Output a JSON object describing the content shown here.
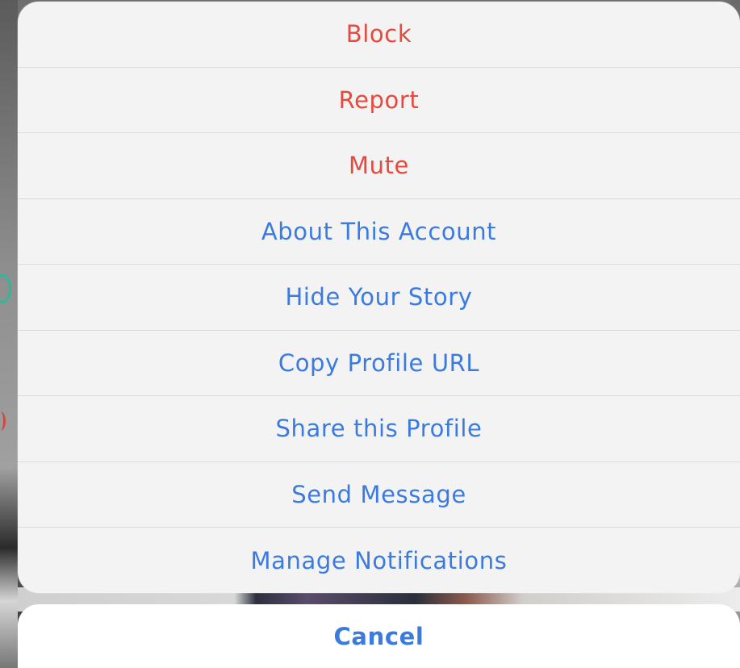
{
  "action_sheet": {
    "items": [
      {
        "label": "Block",
        "style": "destructive"
      },
      {
        "label": "Report",
        "style": "destructive"
      },
      {
        "label": "Mute",
        "style": "destructive"
      },
      {
        "label": "About This Account",
        "style": "default"
      },
      {
        "label": "Hide Your Story",
        "style": "default"
      },
      {
        "label": "Copy Profile URL",
        "style": "default"
      },
      {
        "label": "Share this Profile",
        "style": "default"
      },
      {
        "label": "Send Message",
        "style": "default"
      },
      {
        "label": "Manage Notifications",
        "style": "default"
      }
    ]
  },
  "cancel": {
    "label": "Cancel"
  },
  "colors": {
    "destructive": "#e44a3e",
    "default": "#3b7be0",
    "sheet_background": "#f3f3f3",
    "cancel_background": "#ffffff"
  }
}
